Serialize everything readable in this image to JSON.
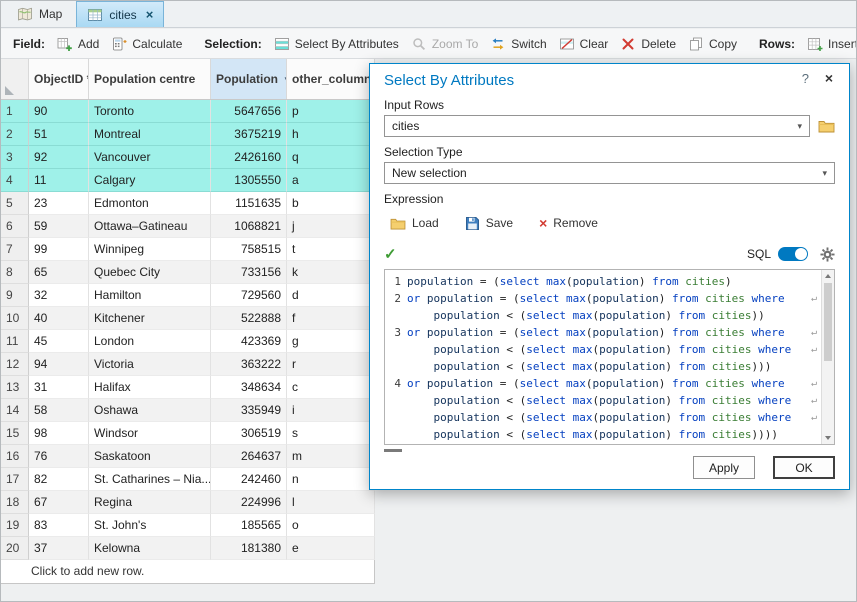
{
  "icons": {
    "help": "?",
    "close": "×",
    "check": "✓",
    "remove_x": "×",
    "sort_desc": "▼",
    "chevron_down": "▾",
    "wrap_mark": "↵"
  },
  "colors": {
    "accent": "#0079c1",
    "selection_cyan": "#9ff1e9",
    "sql_keyword": "#0540c0",
    "sql_table": "#3a7d34"
  },
  "tabs": [
    {
      "label": "Map"
    },
    {
      "label": "cities",
      "active": true
    }
  ],
  "toolbar": {
    "field_label": "Field:",
    "add": "Add",
    "calculate": "Calculate",
    "selection_label": "Selection:",
    "select_by_attributes": "Select By Attributes",
    "zoom_to": "Zoom To",
    "switch": "Switch",
    "clear": "Clear",
    "delete": "Delete",
    "copy": "Copy",
    "rows_label": "Rows:",
    "insert": "Insert"
  },
  "table": {
    "columns": [
      "ObjectID *",
      "Population centre",
      "Population",
      "other_column"
    ],
    "add_row_text": "Click to add new row.",
    "rows": [
      {
        "n": 1,
        "objectid": "90",
        "name": "Toronto",
        "population": "5647656",
        "other": "p",
        "selected": true
      },
      {
        "n": 2,
        "objectid": "51",
        "name": "Montreal",
        "population": "3675219",
        "other": "h",
        "selected": true
      },
      {
        "n": 3,
        "objectid": "92",
        "name": "Vancouver",
        "population": "2426160",
        "other": "q",
        "selected": true
      },
      {
        "n": 4,
        "objectid": "11",
        "name": "Calgary",
        "population": "1305550",
        "other": "a",
        "selected": true
      },
      {
        "n": 5,
        "objectid": "23",
        "name": "Edmonton",
        "population": "1151635",
        "other": "b",
        "selected": false
      },
      {
        "n": 6,
        "objectid": "59",
        "name": "Ottawa–Gatineau",
        "population": "1068821",
        "other": "j",
        "selected": false
      },
      {
        "n": 7,
        "objectid": "99",
        "name": "Winnipeg",
        "population": "758515",
        "other": "t",
        "selected": false
      },
      {
        "n": 8,
        "objectid": "65",
        "name": "Quebec City",
        "population": "733156",
        "other": "k",
        "selected": false
      },
      {
        "n": 9,
        "objectid": "32",
        "name": "Hamilton",
        "population": "729560",
        "other": "d",
        "selected": false
      },
      {
        "n": 10,
        "objectid": "40",
        "name": "Kitchener",
        "population": "522888",
        "other": "f",
        "selected": false
      },
      {
        "n": 11,
        "objectid": "45",
        "name": "London",
        "population": "423369",
        "other": "g",
        "selected": false
      },
      {
        "n": 12,
        "objectid": "94",
        "name": "Victoria",
        "population": "363222",
        "other": "r",
        "selected": false
      },
      {
        "n": 13,
        "objectid": "31",
        "name": "Halifax",
        "population": "348634",
        "other": "c",
        "selected": false
      },
      {
        "n": 14,
        "objectid": "58",
        "name": "Oshawa",
        "population": "335949",
        "other": "i",
        "selected": false
      },
      {
        "n": 15,
        "objectid": "98",
        "name": "Windsor",
        "population": "306519",
        "other": "s",
        "selected": false
      },
      {
        "n": 16,
        "objectid": "76",
        "name": "Saskatoon",
        "population": "264637",
        "other": "m",
        "selected": false
      },
      {
        "n": 17,
        "objectid": "82",
        "name": "St. Catharines – Nia...",
        "population": "242460",
        "other": "n",
        "selected": false
      },
      {
        "n": 18,
        "objectid": "67",
        "name": "Regina",
        "population": "224996",
        "other": "l",
        "selected": false
      },
      {
        "n": 19,
        "objectid": "83",
        "name": "St. John's",
        "population": "185565",
        "other": "o",
        "selected": false
      },
      {
        "n": 20,
        "objectid": "37",
        "name": "Kelowna",
        "population": "181380",
        "other": "e",
        "selected": false
      }
    ]
  },
  "dialog": {
    "title": "Select By Attributes",
    "input_rows": {
      "label": "Input Rows",
      "value": "cities"
    },
    "selection_type": {
      "label": "Selection Type",
      "value": "New selection"
    },
    "expression_label": "Expression",
    "load": "Load",
    "save": "Save",
    "remove": "Remove",
    "sql_label": "SQL",
    "apply": "Apply",
    "ok": "OK",
    "editor": {
      "lines": [
        {
          "n": "1",
          "text": "population = (select max(population) from cities)",
          "wrap": false
        },
        {
          "n": "2",
          "text": "or population = (select max(population) from cities where",
          "wrap": true
        },
        {
          "n": "",
          "text": "    population < (select max(population) from cities))",
          "wrap": false
        },
        {
          "n": "3",
          "text": "or population = (select max(population) from cities where",
          "wrap": true
        },
        {
          "n": "",
          "text": "    population < (select max(population) from cities where",
          "wrap": true
        },
        {
          "n": "",
          "text": "    population < (select max(population) from cities)))",
          "wrap": false
        },
        {
          "n": "4",
          "text": "or population = (select max(population) from cities where",
          "wrap": true
        },
        {
          "n": "",
          "text": "    population < (select max(population) from cities where",
          "wrap": true
        },
        {
          "n": "",
          "text": "    population < (select max(population) from cities where",
          "wrap": true
        },
        {
          "n": "",
          "text": "    population < (select max(population) from cities))))",
          "wrap": false
        }
      ]
    }
  }
}
